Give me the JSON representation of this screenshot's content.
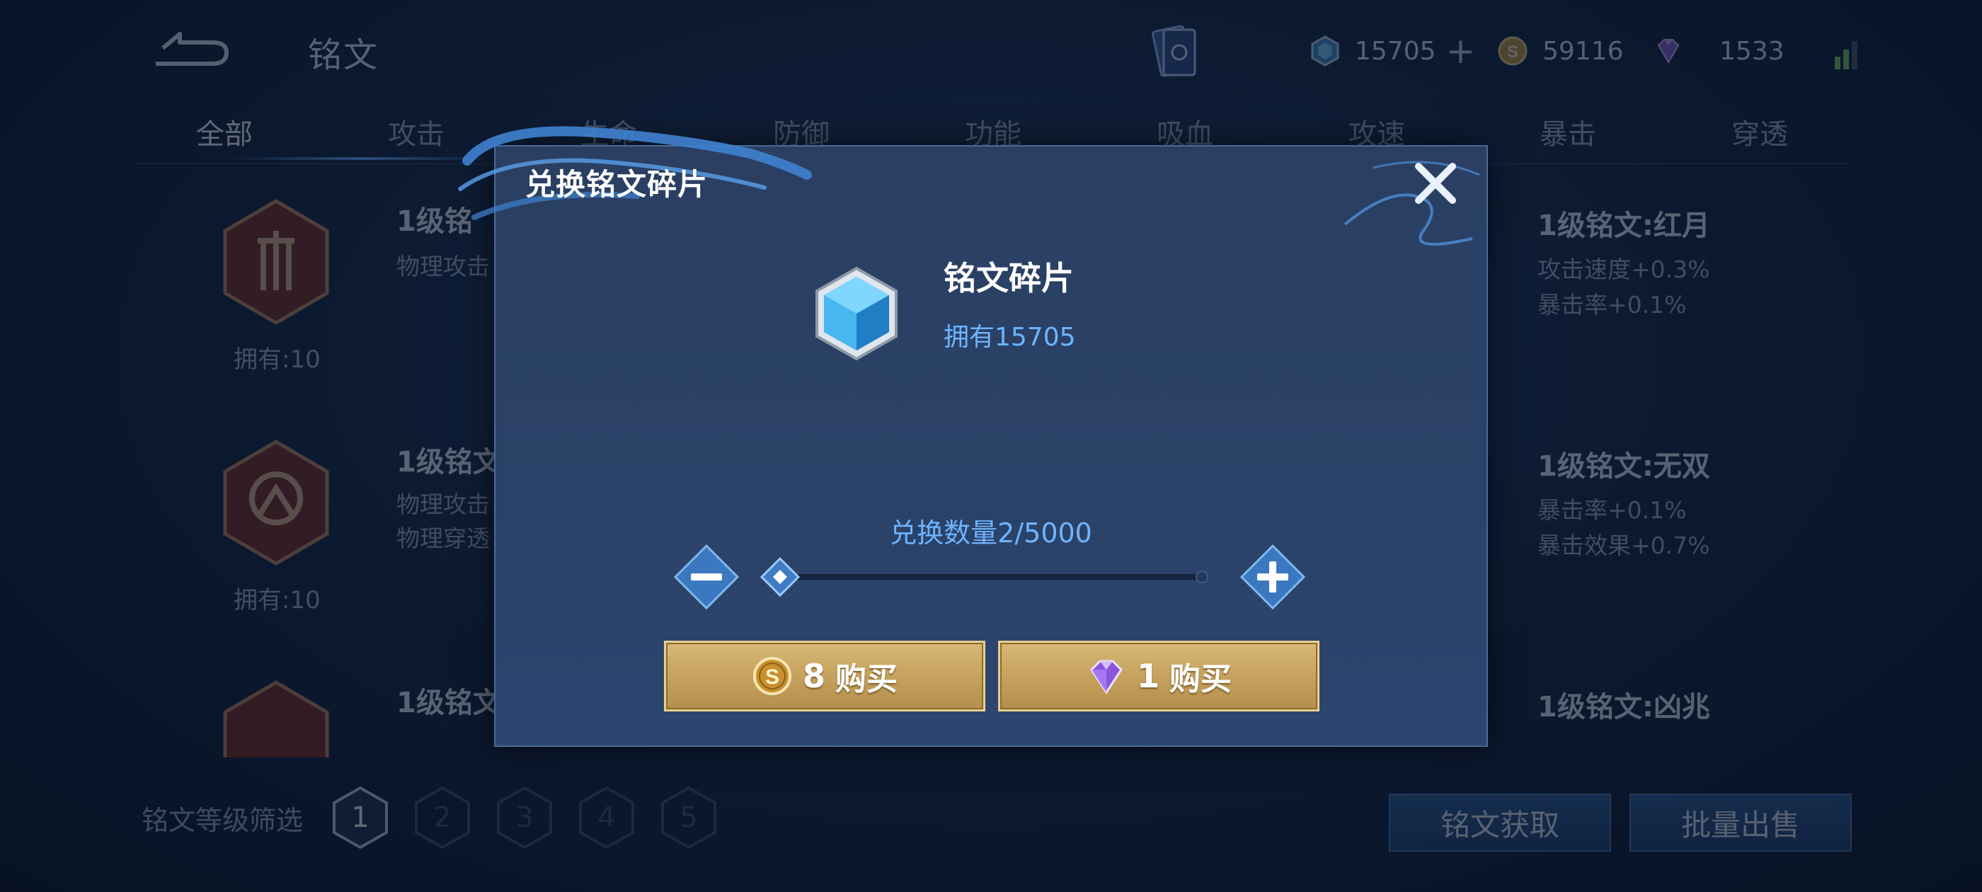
{
  "header": {
    "title": "铭文",
    "currencies": {
      "fragments": "15705",
      "gold": "59116",
      "gems": "1533"
    }
  },
  "tabs": [
    "全部",
    "攻击",
    "生命",
    "防御",
    "功能",
    "吸血",
    "攻速",
    "暴击",
    "穿透"
  ],
  "inscriptions_left": [
    {
      "name": "1级铭",
      "attrs": [
        "物理攻击"
      ],
      "owned": "拥有:10"
    },
    {
      "name": "1级铭文",
      "attrs": [
        "物理攻击",
        "物理穿透"
      ],
      "owned": "拥有:10"
    },
    {
      "name": "1级铭文",
      "attrs": [],
      "owned": ""
    }
  ],
  "inscriptions_right": [
    {
      "name": "1级铭文:红月",
      "attrs": [
        "攻击速度+0.3%",
        "暴击率+0.1%"
      ]
    },
    {
      "name": "1级铭文:无双",
      "attrs": [
        "暴击率+0.1%",
        "暴击效果+0.7%"
      ]
    },
    {
      "name": "1级铭文:凶兆",
      "attrs": []
    }
  ],
  "level_filter": {
    "label": "铭文等级筛选",
    "levels": [
      "1",
      "2",
      "3",
      "4",
      "5"
    ],
    "selected": "1"
  },
  "bottom_buttons": {
    "obtain": "铭文获取",
    "bulk_sell": "批量出售"
  },
  "modal": {
    "title": "兑换铭文碎片",
    "item_name": "铭文碎片",
    "owned": "拥有15705",
    "quantity_label": "兑换数量2/5000",
    "quantity": 2,
    "quantity_max": 5000,
    "buy_gold_amount": "8",
    "buy_gem_amount": "1",
    "buy_label": "购买"
  },
  "colors": {
    "accent_blue": "#6eb4ff",
    "gold_button": "#c7a460",
    "modal_bg": "#2a3f62"
  }
}
